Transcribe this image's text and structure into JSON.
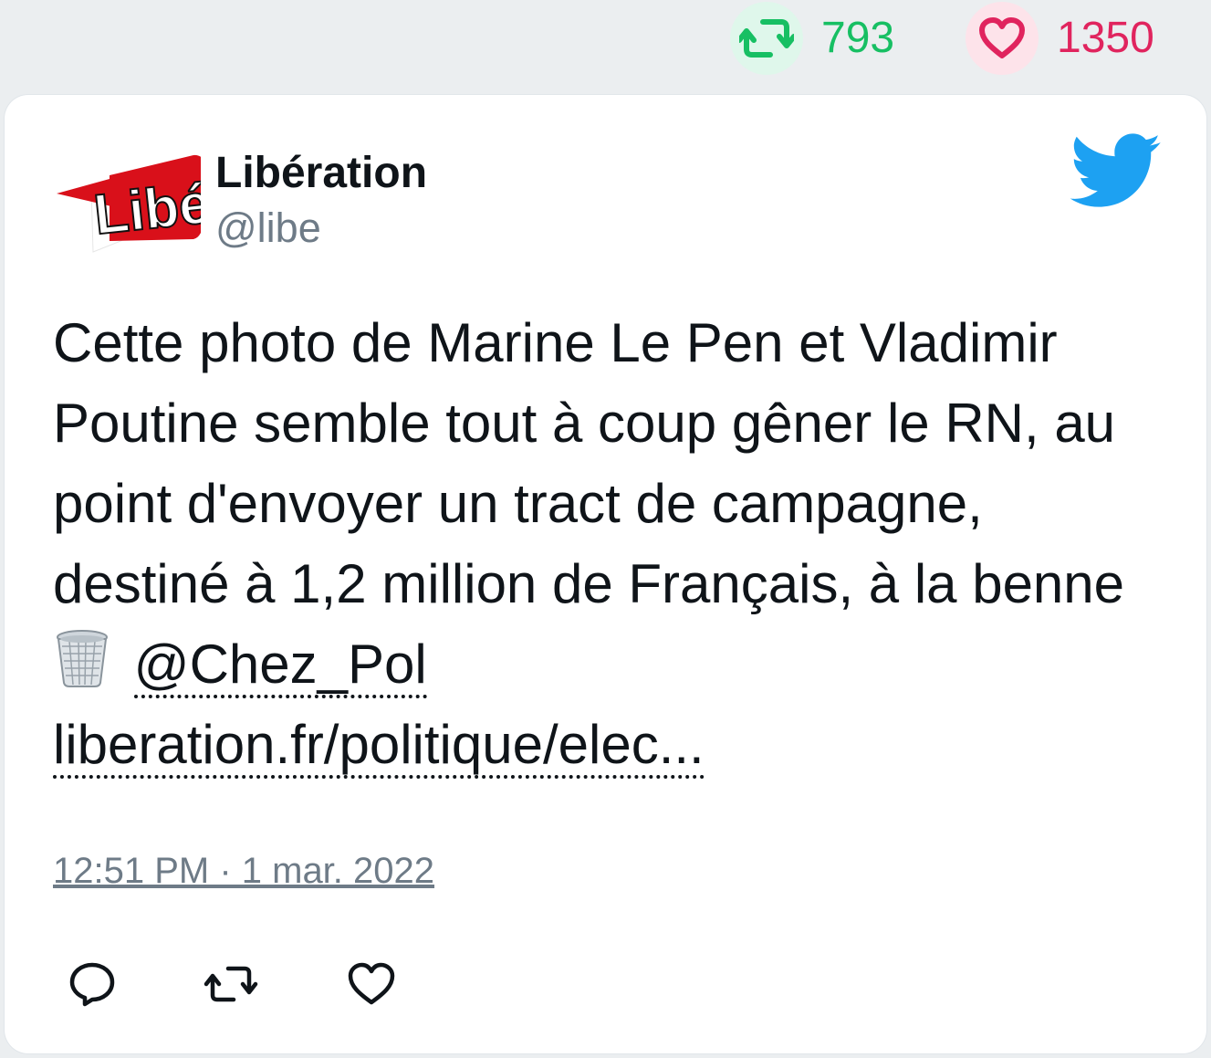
{
  "stats": {
    "retweets": "793",
    "likes": "1350"
  },
  "tweet": {
    "author_name": "Libération",
    "author_handle": "@libe",
    "avatar_logo_text": "Libé",
    "text_main": "Cette photo de Marine Le Pen et Vladimir Poutine semble tout à coup gêner le RN, au point d'envoyer un tract de campagne, destiné à 1,2 million de Français, à la benne",
    "mention": "@Chez_Pol",
    "link": "liberation.fr/politique/elec...",
    "timestamp": "12:51 PM · 1 mar. 2022"
  },
  "icons": {
    "retweet_stat": "retweet-icon",
    "like_stat": "heart-icon",
    "brand": "twitter-bird-icon",
    "emoji": "wastebasket-icon",
    "reply": "reply-icon",
    "retweet": "retweet-icon",
    "like": "heart-icon"
  },
  "colors": {
    "retweet_green": "#17bf63",
    "like_red": "#e0245e",
    "twitter_blue": "#1da1f2",
    "text": "#0f1419",
    "secondary_text": "#6e7b87"
  }
}
